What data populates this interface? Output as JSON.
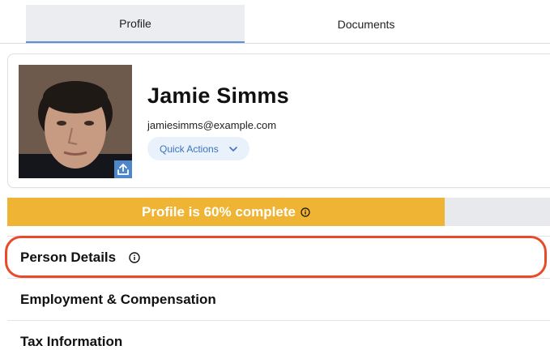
{
  "tabs": [
    {
      "label": "Profile",
      "active": true
    },
    {
      "label": "Documents",
      "active": false
    }
  ],
  "profile": {
    "name": "Jamie Simms",
    "email": "jamiesimms@example.com",
    "quick_actions_label": "Quick Actions",
    "photo_icon": "upload-icon"
  },
  "progress": {
    "label": "Profile is 60% complete",
    "percent": 60,
    "color": "#f0b434"
  },
  "sections": [
    {
      "label": "Person Details",
      "has_info_icon": true,
      "highlighted": true
    },
    {
      "label": "Employment & Compensation"
    },
    {
      "label": "Tax Information"
    }
  ],
  "colors": {
    "accent": "#3b73c0",
    "tab_underline": "#5b8fd6",
    "highlight": "#e84a2a"
  }
}
